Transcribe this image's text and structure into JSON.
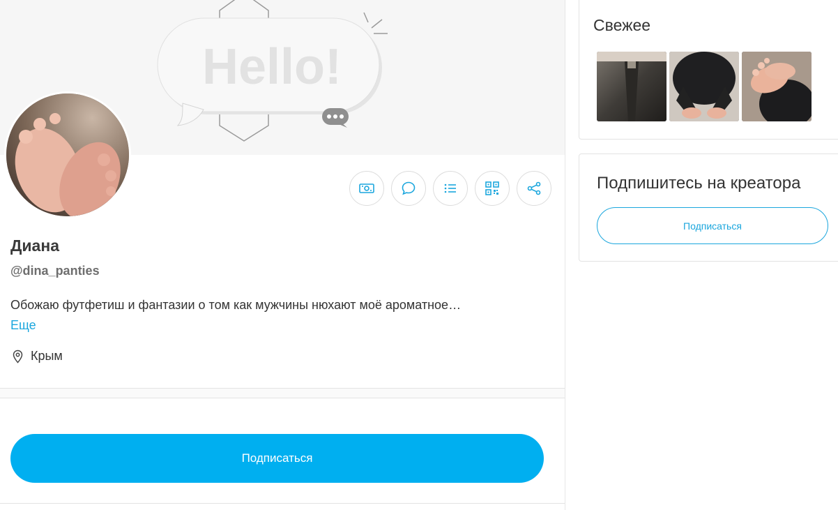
{
  "cover": {
    "greeting": "Hello!"
  },
  "profile": {
    "name": "Диана",
    "handle": "@dina_panties",
    "bio": "Обожаю футфетиш и фантазии о том как мужчины нюхают моё ароматное…",
    "more_label": "Еще",
    "location": "Крым"
  },
  "actions": [
    {
      "icon": "money-icon"
    },
    {
      "icon": "chat-icon"
    },
    {
      "icon": "list-icon"
    },
    {
      "icon": "qr-code-icon"
    },
    {
      "icon": "share-icon"
    }
  ],
  "subscribe_main_label": "Подписаться",
  "sidebar": {
    "fresh_title": "Свежее",
    "subscribe_card": {
      "title": "Подпишитесь на креатора",
      "button_label": "Подписаться"
    }
  },
  "colors": {
    "accent": "#00aff0",
    "link": "#1aa6dd"
  }
}
